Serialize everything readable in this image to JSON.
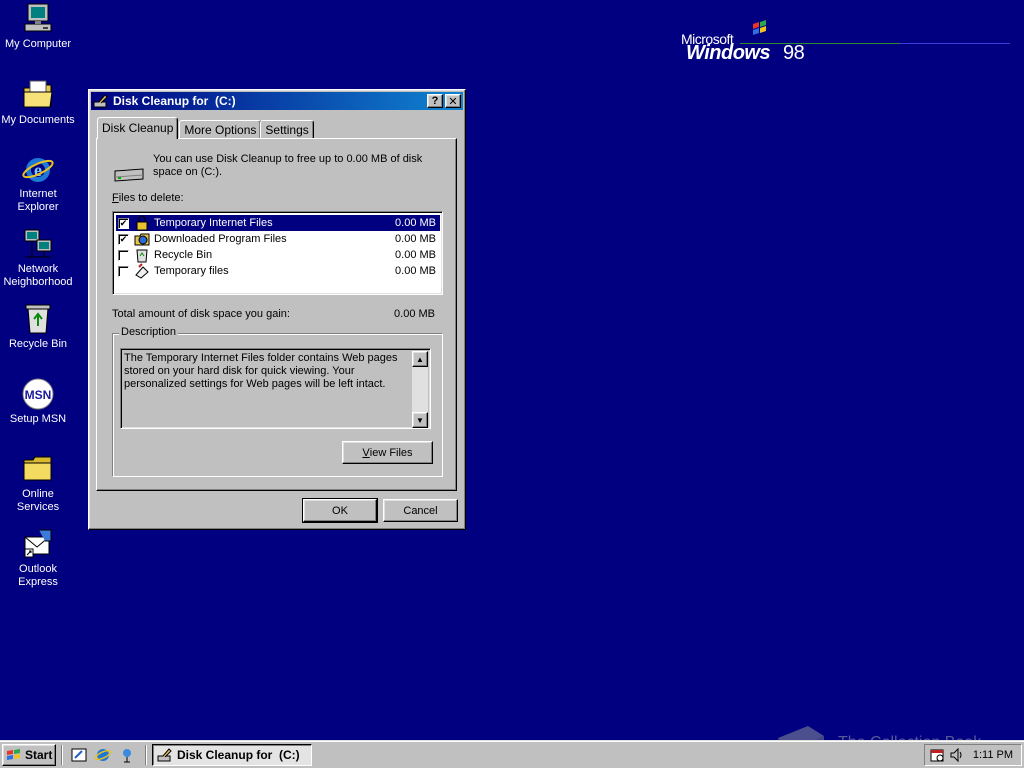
{
  "desktop": {
    "icons": [
      {
        "label": "My Computer",
        "icon": "my-computer-icon"
      },
      {
        "label": "My Documents",
        "icon": "my-documents-icon"
      },
      {
        "label": "Internet Explorer",
        "icon": "internet-explorer-icon"
      },
      {
        "label": "Network Neighborhood",
        "icon": "network-neighborhood-icon"
      },
      {
        "label": "Recycle Bin",
        "icon": "recycle-bin-icon"
      },
      {
        "label": "Setup MSN",
        "icon": "msn-icon"
      },
      {
        "label": "Online Services",
        "icon": "folder-icon"
      },
      {
        "label": "Outlook Express",
        "icon": "outlook-express-icon"
      }
    ],
    "logo": {
      "microsoft": "Microsoft",
      "windows": "Windows",
      "version": "98"
    }
  },
  "dialog": {
    "title": "Disk Cleanup for  (C:)",
    "tabs": [
      {
        "label": "Disk Cleanup",
        "active": true
      },
      {
        "label": "More Options",
        "active": false
      },
      {
        "label": "Settings",
        "active": false
      }
    ],
    "intro": "You can use Disk Cleanup to free up to 0.00 MB of disk space on  (C:).",
    "files_label_access": "F",
    "files_label_rest": "iles to delete:",
    "files": [
      {
        "name": "Temporary Internet Files",
        "size": "0.00 MB",
        "checked": true,
        "selected": true,
        "icon": "lock-icon"
      },
      {
        "name": "Downloaded Program Files",
        "size": "0.00 MB",
        "checked": true,
        "selected": false,
        "icon": "program-files-icon"
      },
      {
        "name": "Recycle Bin",
        "size": "0.00 MB",
        "checked": false,
        "selected": false,
        "icon": "recycle-bin-icon"
      },
      {
        "name": "Temporary files",
        "size": "0.00 MB",
        "checked": false,
        "selected": false,
        "icon": "temp-files-icon"
      }
    ],
    "total_label": "Total amount of disk space you gain:",
    "total_value": "0.00 MB",
    "description_legend": "Description",
    "description_text": "The Temporary Internet Files folder contains Web pages stored on your hard disk for quick viewing. Your personalized settings for Web pages will be left intact.",
    "view_files_access": "V",
    "view_files_rest": "iew Files",
    "ok_label": "OK",
    "cancel_label": "Cancel",
    "help_label": "?",
    "close_label": "✕"
  },
  "taskbar": {
    "start_label": "Start",
    "task_title": "Disk Cleanup for  (C:)",
    "clock": "1:11 PM"
  },
  "watermark": {
    "text": "The Collection Book"
  },
  "colors": {
    "desktop": "#000080",
    "face": "#c0c0c0",
    "title_start": "#000080",
    "title_end": "#1084d0",
    "selection": "#000080"
  }
}
